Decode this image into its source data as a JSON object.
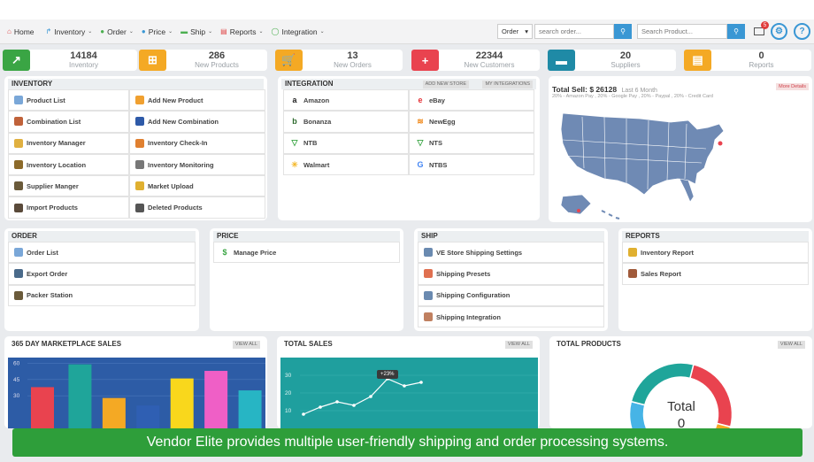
{
  "nav": {
    "items": [
      {
        "label": "Home",
        "icon": "home-icon",
        "glyph": "⌂",
        "color": "#e04848"
      },
      {
        "label": "Inventory",
        "icon": "share-icon",
        "glyph": "↱",
        "color": "#3a97d4"
      },
      {
        "label": "Order",
        "icon": "gear-icon",
        "glyph": "●",
        "color": "#4caf50"
      },
      {
        "label": "Price",
        "icon": "tag-icon",
        "glyph": "●",
        "color": "#3a97d4"
      },
      {
        "label": "Ship",
        "icon": "truck-icon",
        "glyph": "▬",
        "color": "#4caf50"
      },
      {
        "label": "Reports",
        "icon": "report-icon",
        "glyph": "▤",
        "color": "#e04848"
      },
      {
        "label": "Integration",
        "icon": "integration-icon",
        "glyph": "◯",
        "color": "#4caf50"
      }
    ],
    "order_select": "Order",
    "search_order_placeholder": "search order...",
    "search_product_placeholder": "Search Product...",
    "mail_badge": "5"
  },
  "stats": [
    {
      "value": "14184",
      "label": "Inventory",
      "icon": "chart-up-icon",
      "glyph": "↗",
      "color": "#3aa544"
    },
    {
      "value": "286",
      "label": "New Products",
      "icon": "plus-box-icon",
      "glyph": "⊞",
      "color": "#f4a924"
    },
    {
      "value": "13",
      "label": "New Orders",
      "icon": "cart-icon",
      "glyph": "🛒",
      "color": "#f4a924"
    },
    {
      "value": "22344",
      "label": "New Customers",
      "icon": "add-user-icon",
      "glyph": "+",
      "color": "#e9434f"
    },
    {
      "value": "20",
      "label": "Suppliers",
      "icon": "truck-icon",
      "glyph": "▬",
      "color": "#1f8aa6"
    },
    {
      "value": "0",
      "label": "Reports",
      "icon": "document-icon",
      "glyph": "▤",
      "color": "#f4a924"
    }
  ],
  "inventory": {
    "title": "INVENTORY",
    "items": [
      {
        "label": "Product List",
        "color": "#7aa7d8"
      },
      {
        "label": "Add New Product",
        "color": "#f0a030"
      },
      {
        "label": "Combination List",
        "color": "#c0623a"
      },
      {
        "label": "Add New Combination",
        "color": "#2e5aa8"
      },
      {
        "label": "Inventory Manager",
        "color": "#e0b040"
      },
      {
        "label": "Inventory Check-In",
        "color": "#e08030"
      },
      {
        "label": "Inventory Location",
        "color": "#8c6a2a"
      },
      {
        "label": "Inventory Monitoring",
        "color": "#777777"
      },
      {
        "label": "Supplier Manger",
        "color": "#6a5a3a"
      },
      {
        "label": "Market Upload",
        "color": "#e0b030"
      },
      {
        "label": "Import Products",
        "color": "#5a4a3a"
      },
      {
        "label": "Deleted Products",
        "color": "#555555"
      }
    ]
  },
  "integration": {
    "title": "INTEGRATION",
    "add_store": "ADD NEW STORE",
    "my_integrations": "MY INTEGRATIONS",
    "items": [
      {
        "label": "Amazon",
        "glyph": "a",
        "color": "#222"
      },
      {
        "label": "eBay",
        "glyph": "e",
        "color": "#e53238"
      },
      {
        "label": "Bonanza",
        "glyph": "b",
        "color": "#2d6a2d"
      },
      {
        "label": "NewEgg",
        "glyph": "≋",
        "color": "#f08a1c"
      },
      {
        "label": "NTB",
        "glyph": "▽",
        "color": "#3aa544"
      },
      {
        "label": "NTS",
        "glyph": "▽",
        "color": "#3aa544"
      },
      {
        "label": "Walmart",
        "glyph": "✳",
        "color": "#f4b82a"
      },
      {
        "label": "NTBS",
        "glyph": "G",
        "color": "#4285f4"
      }
    ]
  },
  "total_sell": {
    "label": "Total Sell: $ 26128",
    "period": "Last 6 Month",
    "breakdown": "20% - Amazon Pay , 20% - Google Pay , 20% - Paypal , 20% - Credit Card",
    "more": "More Details"
  },
  "order": {
    "title": "ORDER",
    "items": [
      {
        "label": "Order List",
        "color": "#7aa7d8"
      },
      {
        "label": "Export Order",
        "color": "#4a6a8a"
      },
      {
        "label": "Packer Station",
        "color": "#6a5a3a"
      }
    ]
  },
  "price": {
    "title": "PRICE",
    "items": [
      {
        "label": "Manage Price",
        "glyph": "$",
        "color": "#3aa544"
      }
    ]
  },
  "ship": {
    "title": "SHIP",
    "items": [
      {
        "label": "VE Store Shipping Settings",
        "color": "#6a8ab0"
      },
      {
        "label": "Shipping Presets",
        "color": "#e07050"
      },
      {
        "label": "Shipping Configuration",
        "color": "#6a8ab0"
      },
      {
        "label": "Shipping Integration",
        "color": "#c08060"
      }
    ]
  },
  "reports": {
    "title": "REPORTS",
    "items": [
      {
        "label": "Inventory Report",
        "color": "#e0b030"
      },
      {
        "label": "Sales Report",
        "color": "#a05a3a"
      }
    ]
  },
  "marketplace": {
    "title": "365 DAY MARKETPLACE SALES",
    "view_all": "VIEW ALL"
  },
  "total_sales": {
    "title": "TOTAL SALES",
    "view_all": "VIEW ALL",
    "tooltip": "+23%"
  },
  "total_products": {
    "title": "TOTAL PRODUCTS",
    "view_all": "VIEW ALL",
    "center_label": "Total",
    "center_value": "0"
  },
  "chart_data": [
    {
      "type": "bar",
      "title": "365 DAY MARKETPLACE SALES",
      "yticks": [
        30,
        45,
        60
      ],
      "ylim": [
        0,
        62
      ],
      "series": [
        {
          "values": [
            38,
            59,
            28,
            21,
            46,
            53,
            35
          ]
        }
      ],
      "colors": [
        "#e9434f",
        "#1fa59a",
        "#f4a924",
        "#2f5fb3",
        "#f9d71c",
        "#ef5fc6",
        "#27b5c4"
      ]
    },
    {
      "type": "line",
      "title": "TOTAL SALES",
      "yticks": [
        10,
        20,
        30
      ],
      "ylim": [
        0,
        38
      ],
      "x": [
        1,
        2,
        3,
        4,
        5,
        6,
        7,
        8
      ],
      "series": [
        {
          "values": [
            8,
            12,
            15,
            13,
            18,
            28,
            24,
            26
          ]
        }
      ],
      "background": "#1f9f9e"
    },
    {
      "type": "pie",
      "title": "TOTAL PRODUCTS",
      "values": [
        25,
        25,
        25,
        25
      ],
      "colors": [
        "#e9434f",
        "#f4a924",
        "#46b4e6",
        "#1fa59a"
      ]
    }
  ],
  "caption": "Vendor Elite provides multiple user-friendly shipping and order processing systems."
}
